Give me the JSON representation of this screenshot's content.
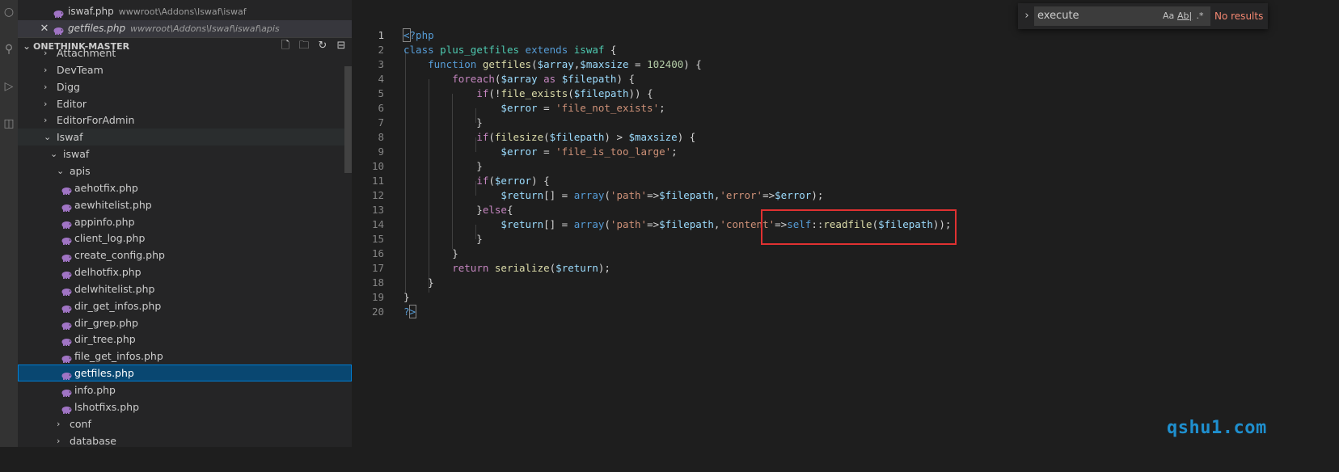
{
  "open_editors": [
    {
      "name": "iswaf.php",
      "path": "wwwroot\\Addons\\Iswaf\\iswaf",
      "active": false
    },
    {
      "name": "getfiles.php",
      "path": "wwwroot\\Addons\\Iswaf\\iswaf\\apis",
      "active": true
    }
  ],
  "explorer": {
    "title": "ONETHINK-MASTER",
    "actions": [
      "new-file-icon",
      "new-folder-icon",
      "refresh-icon",
      "collapse-all-icon"
    ]
  },
  "tree": [
    {
      "label": "Attachment",
      "kind": "folder",
      "depth": 1
    },
    {
      "label": "DevTeam",
      "kind": "folder",
      "depth": 1
    },
    {
      "label": "Digg",
      "kind": "folder",
      "depth": 1
    },
    {
      "label": "Editor",
      "kind": "folder",
      "depth": 1
    },
    {
      "label": "EditorForAdmin",
      "kind": "folder",
      "depth": 1
    },
    {
      "label": "Iswaf",
      "kind": "folder-open",
      "depth": 1
    },
    {
      "label": "iswaf",
      "kind": "folder-open",
      "depth": 2
    },
    {
      "label": "apis",
      "kind": "folder-open",
      "depth": 3
    },
    {
      "label": "aehotfix.php",
      "kind": "file",
      "depth": 4
    },
    {
      "label": "aewhitelist.php",
      "kind": "file",
      "depth": 4
    },
    {
      "label": "appinfo.php",
      "kind": "file",
      "depth": 4
    },
    {
      "label": "client_log.php",
      "kind": "file",
      "depth": 4
    },
    {
      "label": "create_config.php",
      "kind": "file",
      "depth": 4
    },
    {
      "label": "delhotfix.php",
      "kind": "file",
      "depth": 4
    },
    {
      "label": "delwhitelist.php",
      "kind": "file",
      "depth": 4
    },
    {
      "label": "dir_get_infos.php",
      "kind": "file",
      "depth": 4
    },
    {
      "label": "dir_grep.php",
      "kind": "file",
      "depth": 4
    },
    {
      "label": "dir_tree.php",
      "kind": "file",
      "depth": 4
    },
    {
      "label": "file_get_infos.php",
      "kind": "file",
      "depth": 4
    },
    {
      "label": "getfiles.php",
      "kind": "file",
      "depth": 4,
      "selected": true
    },
    {
      "label": "info.php",
      "kind": "file",
      "depth": 4
    },
    {
      "label": "lshotfixs.php",
      "kind": "file",
      "depth": 4
    },
    {
      "label": "conf",
      "kind": "folder",
      "depth": 3
    },
    {
      "label": "database",
      "kind": "folder",
      "depth": 3
    }
  ],
  "find": {
    "value": "execute",
    "match_case": "Aa",
    "whole_word": "Ab|",
    "regex": ".*",
    "result": "No results"
  },
  "code_lines": [
    "<?php",
    "class plus_getfiles extends iswaf {",
    "    function getfiles($array,$maxsize = 102400) {",
    "        foreach($array as $filepath) {",
    "            if(!file_exists($filepath)) {",
    "                $error = 'file_not_exists';",
    "            }",
    "            if(filesize($filepath) > $maxsize) {",
    "                $error = 'file_is_too_large';",
    "            }",
    "            if($error) {",
    "                $return[] = array('path'=>$filepath,'error'=>$error);",
    "            }else{",
    "                $return[] = array('path'=>$filepath,'content'=>self::readfile($filepath));",
    "            }",
    "        }",
    "        return serialize($return);",
    "    }",
    "}",
    "?>"
  ],
  "line_numbers": [
    "1",
    "2",
    "3",
    "4",
    "5",
    "6",
    "7",
    "8",
    "9",
    "10",
    "11",
    "12",
    "13",
    "14",
    "15",
    "16",
    "17",
    "18",
    "19",
    "20"
  ],
  "current_line": 1,
  "watermark": "qshu1.com",
  "colors": {
    "keyword": "#569cd6",
    "control": "#c586c0",
    "variable": "#9cdcfe",
    "function": "#dcdcaa",
    "string": "#ce9178",
    "number": "#b5cea8",
    "class": "#4ec9b0",
    "highlight_box": "#e03131",
    "watermark": "#1f8fce"
  }
}
